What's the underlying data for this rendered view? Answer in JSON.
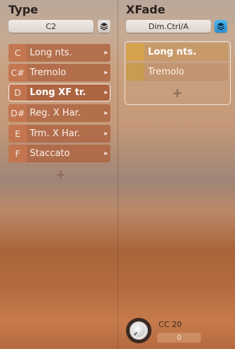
{
  "type_panel": {
    "title": "Type",
    "selector_value": "C2",
    "add_label": "+",
    "articulations": [
      {
        "key": "C",
        "label": "Long nts."
      },
      {
        "key": "C#",
        "label": "Tremolo"
      },
      {
        "key": "D",
        "label": "Long XF tr."
      },
      {
        "key": "D#",
        "label": "Reg. X Har."
      },
      {
        "key": "E",
        "label": "Trm. X Har."
      },
      {
        "key": "F",
        "label": "Staccato"
      }
    ],
    "selected_index": 2
  },
  "xfade_panel": {
    "title": "XFade",
    "selector_value": "Dim.Ctrl/A",
    "add_label": "+",
    "items": [
      {
        "label": "Long nts."
      },
      {
        "label": "Tremolo"
      }
    ],
    "active_index": 0
  },
  "cc": {
    "label": "CC 20",
    "value": "0"
  },
  "colors": {
    "accent_blue": "#2a8fd0",
    "row_orange": "#af6441",
    "xfade_swatch": "#d4a24f"
  },
  "icons": {
    "stack": "layers-icon",
    "chevron": "chevron-right-icon",
    "knob": "knob-icon"
  }
}
